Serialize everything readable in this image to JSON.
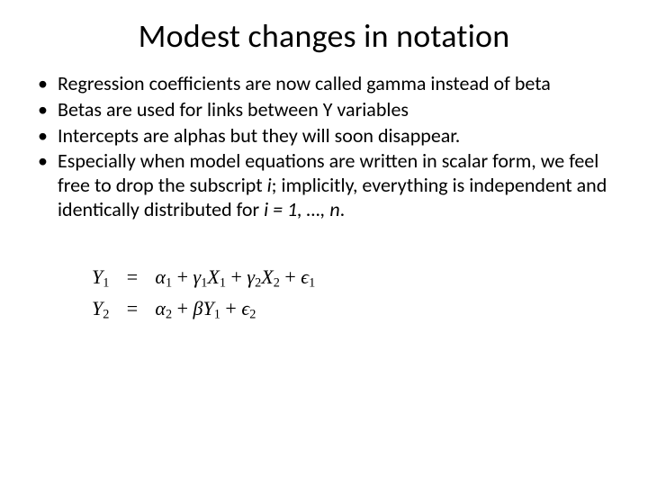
{
  "title": "Modest changes in notation",
  "bullets": [
    {
      "text": "Regression coefficients are now called gamma instead of beta"
    },
    {
      "text": "Betas are used for links between Y variables"
    },
    {
      "text": "Intercepts are alphas but they will soon disappear."
    },
    {
      "text_pre": "Especially when model equations are written in scalar form, we feel free to drop the subscript ",
      "i1": "i",
      "mid": "; implicitly, everything is independent and identically distributed for ",
      "i2": "i = 1, …, n",
      "post": "."
    }
  ],
  "equations": {
    "row1": {
      "lhs_var": "Y",
      "lhs_sub": "1",
      "eq": "=",
      "a": "α",
      "a_sub": "1",
      "plus1": " + ",
      "g1": "γ",
      "g1_sub": "1",
      "x1": "X",
      "x1_sub": "1",
      "plus2": " + ",
      "g2": "γ",
      "g2_sub": "2",
      "x2": "X",
      "x2_sub": "2",
      "plus3": " + ",
      "e": "ϵ",
      "e_sub": "1"
    },
    "row2": {
      "lhs_var": "Y",
      "lhs_sub": "2",
      "eq": "=",
      "a": "α",
      "a_sub": "2",
      "plus1": " + ",
      "b": "β",
      "y": "Y",
      "y_sub": "1",
      "plus2": " + ",
      "e": "ϵ",
      "e_sub": "2"
    }
  }
}
